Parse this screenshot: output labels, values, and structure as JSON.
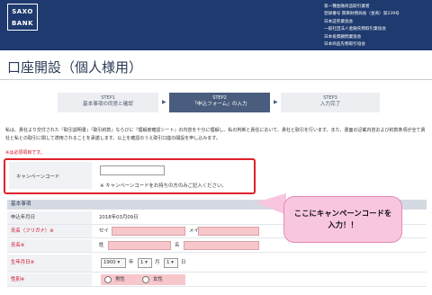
{
  "header": {
    "logo_line1": "SAXO",
    "logo_line2": "BANK",
    "reg_lines": [
      "第一種金融商品取引業者",
      "登録番号 関東財務局長（金商）第239号",
      "日本証券業協会",
      "一般社団法人金融先物取引業協会",
      "日本投資顧問業協会",
      "日本商品先物取引協会"
    ]
  },
  "page_title": "口座開設（個人様用）",
  "steps": [
    {
      "num": "STEP1",
      "label": "基本事項の同意と確認"
    },
    {
      "num": "STEP2",
      "label": "「申込フォーム」の入力"
    },
    {
      "num": "STEP3",
      "label": "入力完了"
    }
  ],
  "arrow_glyph": "▶",
  "intro_text": "私は、貴社より交付された『取引説明書』『取引約款』ならびに『理解度確認シート』の内容を十分に理解し、私の判断と責任において、貴社と取引を行います。また、書面の記載内容および約款条項が全て貴社と私との取引に関して適用されることを承諾します。以上を確認のうえ取引口座の開設を申し込みます。",
  "required_note": "※は必須項目です。",
  "campaign": {
    "label": "キャンペーンコード",
    "value": "",
    "help": "※ キャンペーンコードをお持ちの方のみご記入ください。"
  },
  "section_title": "基本事項",
  "form": {
    "application_date": {
      "label": "申込年月日",
      "value": "2018年03月09日"
    },
    "furigana": {
      "label": "氏名（フリガナ）",
      "mark": "※",
      "sei": "セイ",
      "mei": "メイ"
    },
    "name": {
      "label": "氏名",
      "mark": "※",
      "sei": "姓",
      "mei": "名"
    },
    "birthdate": {
      "label": "生年月日",
      "mark": "※",
      "year": "1900",
      "year_unit": "年",
      "month": "1",
      "month_unit": "月",
      "day": "1",
      "day_unit": "日",
      "chev": "▾"
    },
    "gender": {
      "label": "性別",
      "mark": "※",
      "male": "男性",
      "female": "女性"
    }
  },
  "callout": {
    "line1": "ここにキャンペーンコードを",
    "line2": "入力！！"
  },
  "colors": {
    "header_bg": "#1e3a6e",
    "highlight": "#e0202a",
    "callout_bg": "#f9c6e0",
    "required": "#d0021b"
  }
}
